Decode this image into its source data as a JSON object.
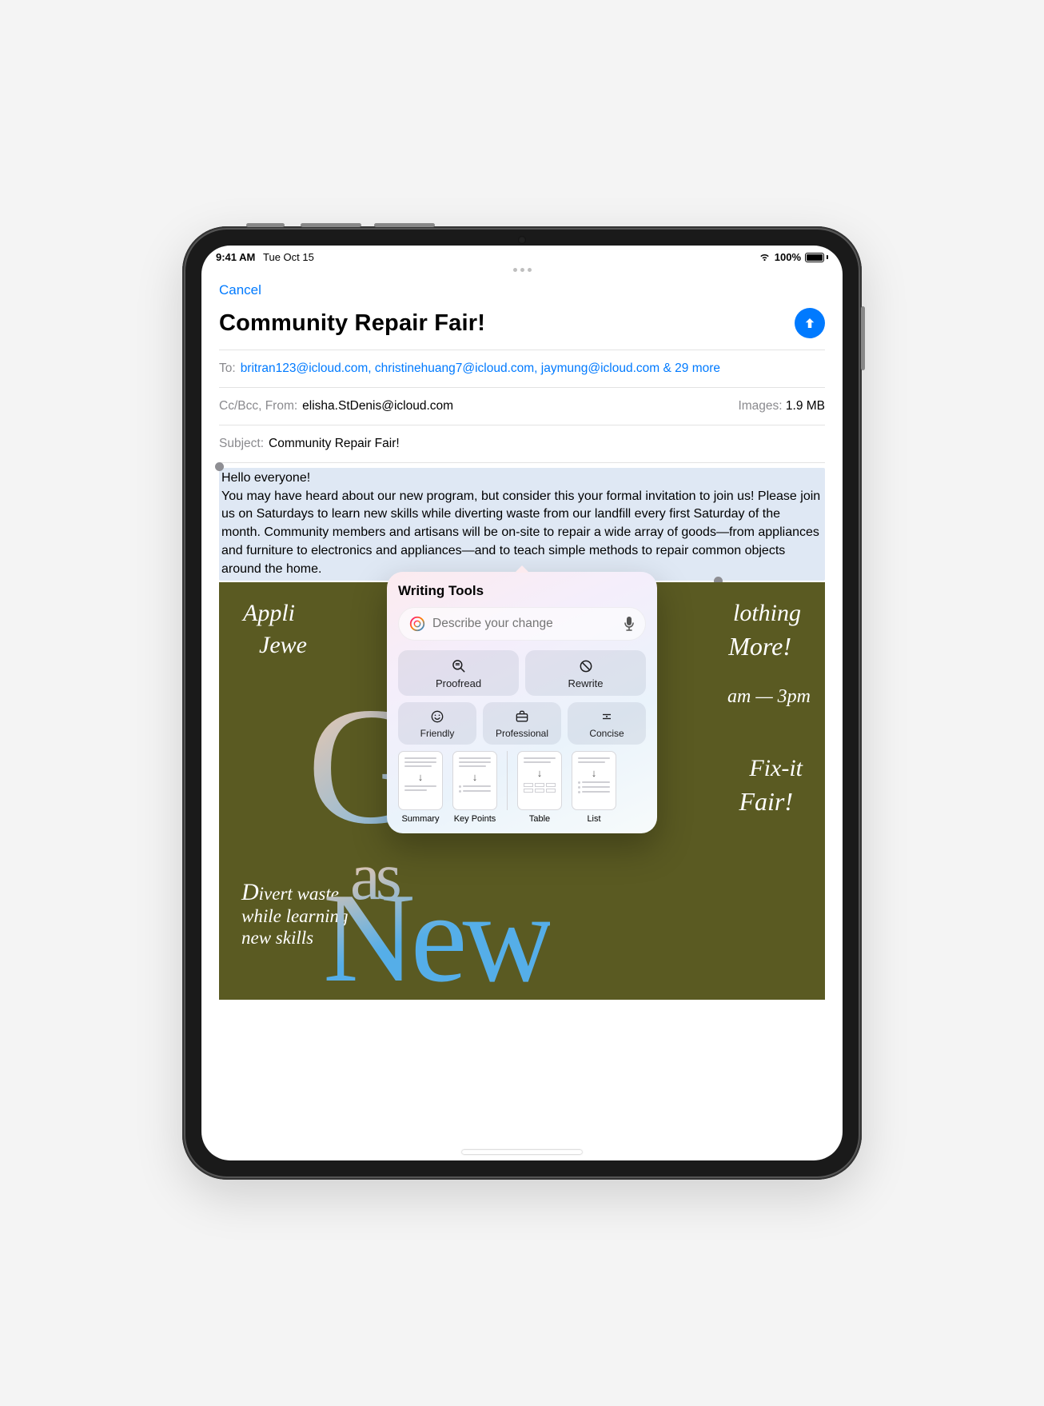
{
  "status": {
    "time": "9:41 AM",
    "date": "Tue Oct 15",
    "battery_pct": "100%"
  },
  "compose": {
    "cancel": "Cancel",
    "subject_display": "Community Repair Fair!",
    "to_label": "To:",
    "to_value": "britran123@icloud.com, christinehuang7@icloud.com, jaymung@icloud.com & 29 more",
    "cc_label": "Cc/Bcc, From:",
    "from_value": "elisha.StDenis@icloud.com",
    "images_label": "Images:",
    "images_value": "1.9 MB",
    "subject_label": "Subject:",
    "subject_value": "Community Repair Fair!",
    "body": "Hello everyone!\nYou may have heard about our new program, but consider this your formal invitation to join us! Please join us on Saturdays to learn new skills while diverting waste from our landfill every first Saturday of the month. Community members and artisans will be on-site to repair a wide array of goods—from appliances and furniture to electronics and appliances—and to teach simple methods to repair common objects around the home."
  },
  "poster": {
    "topleft1": "Appli",
    "topleft2": "Jewe",
    "topright1": "lothing",
    "topright2": "More!",
    "time": "am — 3pm",
    "fixit1": "Fix-it",
    "fixit2": "Fair!",
    "bottomleft": "ivert waste\nwhile learning\nnew skills",
    "bigG": "G",
    "as": "as",
    "new": "New"
  },
  "wt": {
    "title": "Writing Tools",
    "placeholder": "Describe your change",
    "proofread": "Proofread",
    "rewrite": "Rewrite",
    "friendly": "Friendly",
    "professional": "Professional",
    "concise": "Concise",
    "summary": "Summary",
    "keypoints": "Key Points",
    "table": "Table",
    "list": "List"
  }
}
